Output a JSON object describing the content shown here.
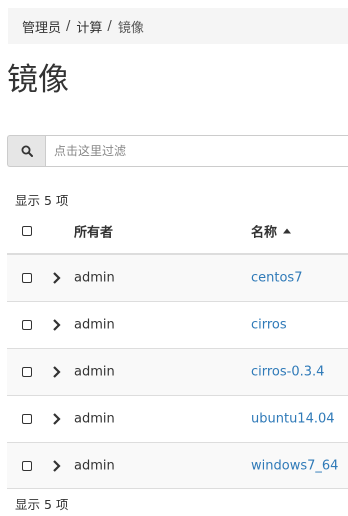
{
  "breadcrumb": {
    "items": [
      "管理员",
      "计算"
    ],
    "current": "镜像",
    "separator": "/"
  },
  "page_title": "镜像",
  "filter": {
    "placeholder": "点击这里过滤",
    "value": ""
  },
  "item_count_label": "显示 5 项",
  "table": {
    "columns": {
      "owner": "所有者",
      "name": "名称"
    },
    "sort": {
      "column": "name",
      "direction": "ascending"
    },
    "rows": [
      {
        "owner": "admin",
        "name": "centos7"
      },
      {
        "owner": "admin",
        "name": "cirros"
      },
      {
        "owner": "admin",
        "name": "cirros-0.3.4"
      },
      {
        "owner": "admin",
        "name": "ubuntu14.04"
      },
      {
        "owner": "admin",
        "name": "windows7_64"
      }
    ]
  },
  "colors": {
    "link": "#2f7ab8",
    "breadcrumb_bg": "#f5f5f5",
    "stripe": "#f9f9f9"
  }
}
